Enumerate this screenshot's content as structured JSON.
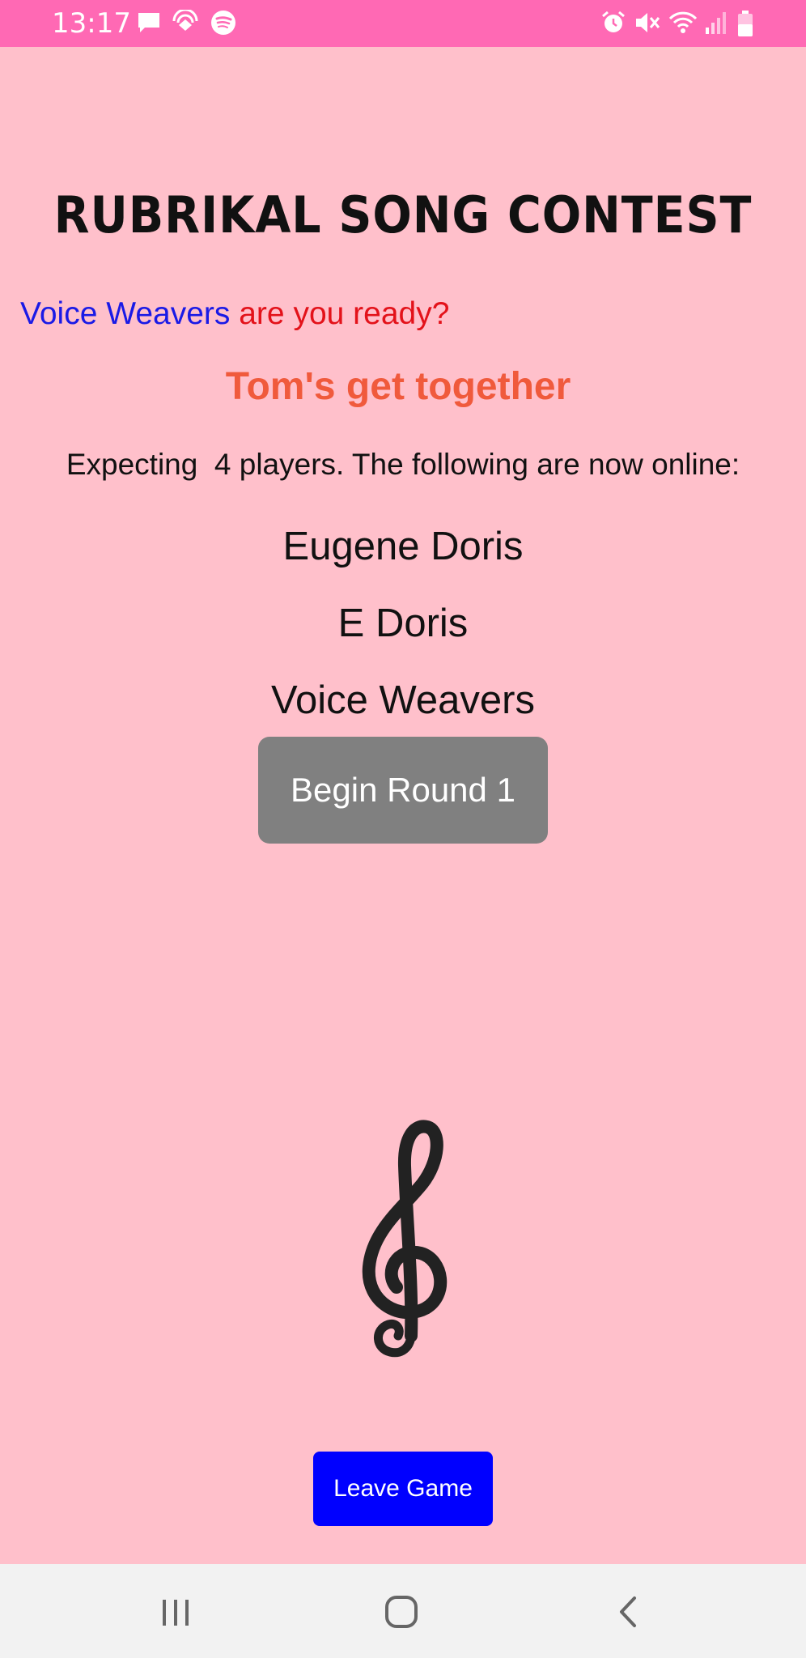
{
  "status_bar": {
    "time": "13:17",
    "left_icons": [
      "message-icon",
      "cast-icon",
      "spotify-icon"
    ],
    "right_icons": [
      "alarm-icon",
      "mute-icon",
      "wifi-icon",
      "signal-icon",
      "battery-icon"
    ]
  },
  "header": {
    "title": "RUBRIKAL SONG CONTEST"
  },
  "greeting": {
    "team_name": "Voice Weavers",
    "question": " are you ready?"
  },
  "game": {
    "name": "Tom's get together",
    "expecting_text": "Expecting  4 players. The following are now online:"
  },
  "players": [
    "Eugene Doris",
    "E Doris",
    "Voice Weavers"
  ],
  "actions": {
    "begin_label": "Begin Round 1",
    "leave_label": "Leave Game"
  },
  "decoration": {
    "icon": "treble-clef-icon"
  },
  "nav_bar": {
    "buttons": [
      "recent-apps-icon",
      "home-icon",
      "back-icon"
    ]
  },
  "colors": {
    "background": "#ffc0cb",
    "status_bar": "#ff69b4",
    "team_name": "#1a1ae6",
    "question": "#e3121a",
    "game_name": "#f05a3c",
    "begin_button": "#808080",
    "leave_button": "#0000ff"
  }
}
